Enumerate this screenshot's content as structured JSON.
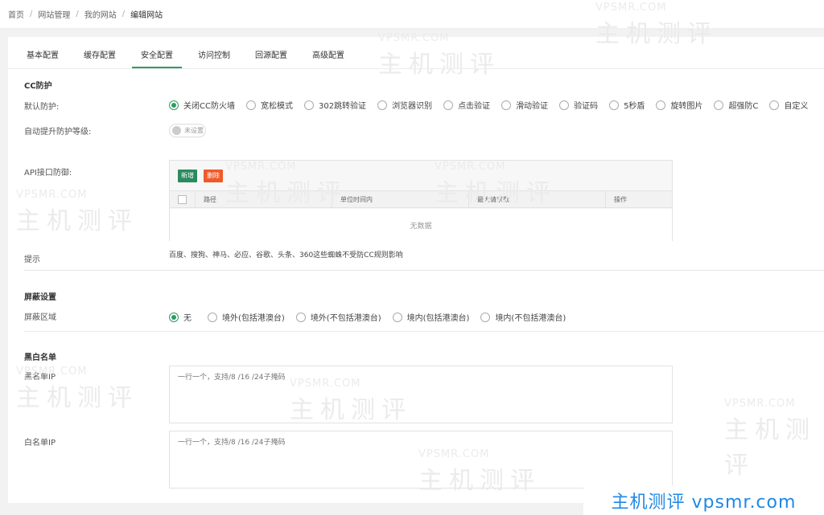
{
  "breadcrumb": [
    "首页",
    "网站管理",
    "我的网站",
    "编辑网站"
  ],
  "breadcrumb_sep": "/",
  "tabs": [
    "基本配置",
    "缓存配置",
    "安全配置",
    "访问控制",
    "回源配置",
    "高级配置"
  ],
  "active_tab": "安全配置",
  "cc": {
    "title": "CC防护",
    "default_label": "默认防护:",
    "options": [
      "关闭CC防火墙",
      "宽松模式",
      "302跳转验证",
      "浏览器识别",
      "点击验证",
      "滑动验证",
      "验证码",
      "5秒盾",
      "旋转图片",
      "超强防C",
      "自定义"
    ],
    "selected": "关闭CC防火墙",
    "auto_label": "自动提升防护等级:",
    "auto_value": "未设置",
    "api_label": "API接口防御:",
    "add_btn": "新增",
    "del_btn": "删除",
    "columns": [
      "路径",
      "单位时间内",
      "最大请求数",
      "操作"
    ],
    "empty": "无数据",
    "tip_label": "提示",
    "tip_text": "百度、搜狗、神马、必应、谷歌、头条、360这些蜘蛛不受防CC规则影响"
  },
  "shield": {
    "title": "屏蔽设置",
    "region_label": "屏蔽区域",
    "options": [
      "无",
      "境外(包括港澳台)",
      "境外(不包括港澳台)",
      "境内(包括港澳台)",
      "境内(不包括港澳台)"
    ],
    "selected": "无"
  },
  "bw": {
    "title": "黑白名单",
    "black_label": "黑名单IP",
    "white_label": "白名单IP",
    "placeholder": "一行一个，支持/8 /16 /24子掩码"
  },
  "watermark": {
    "url": "VPSMR.COM",
    "cn": "主机测评",
    "footer": "主机测评 vpsmr.com"
  },
  "accent_color": "#2a9d5f"
}
